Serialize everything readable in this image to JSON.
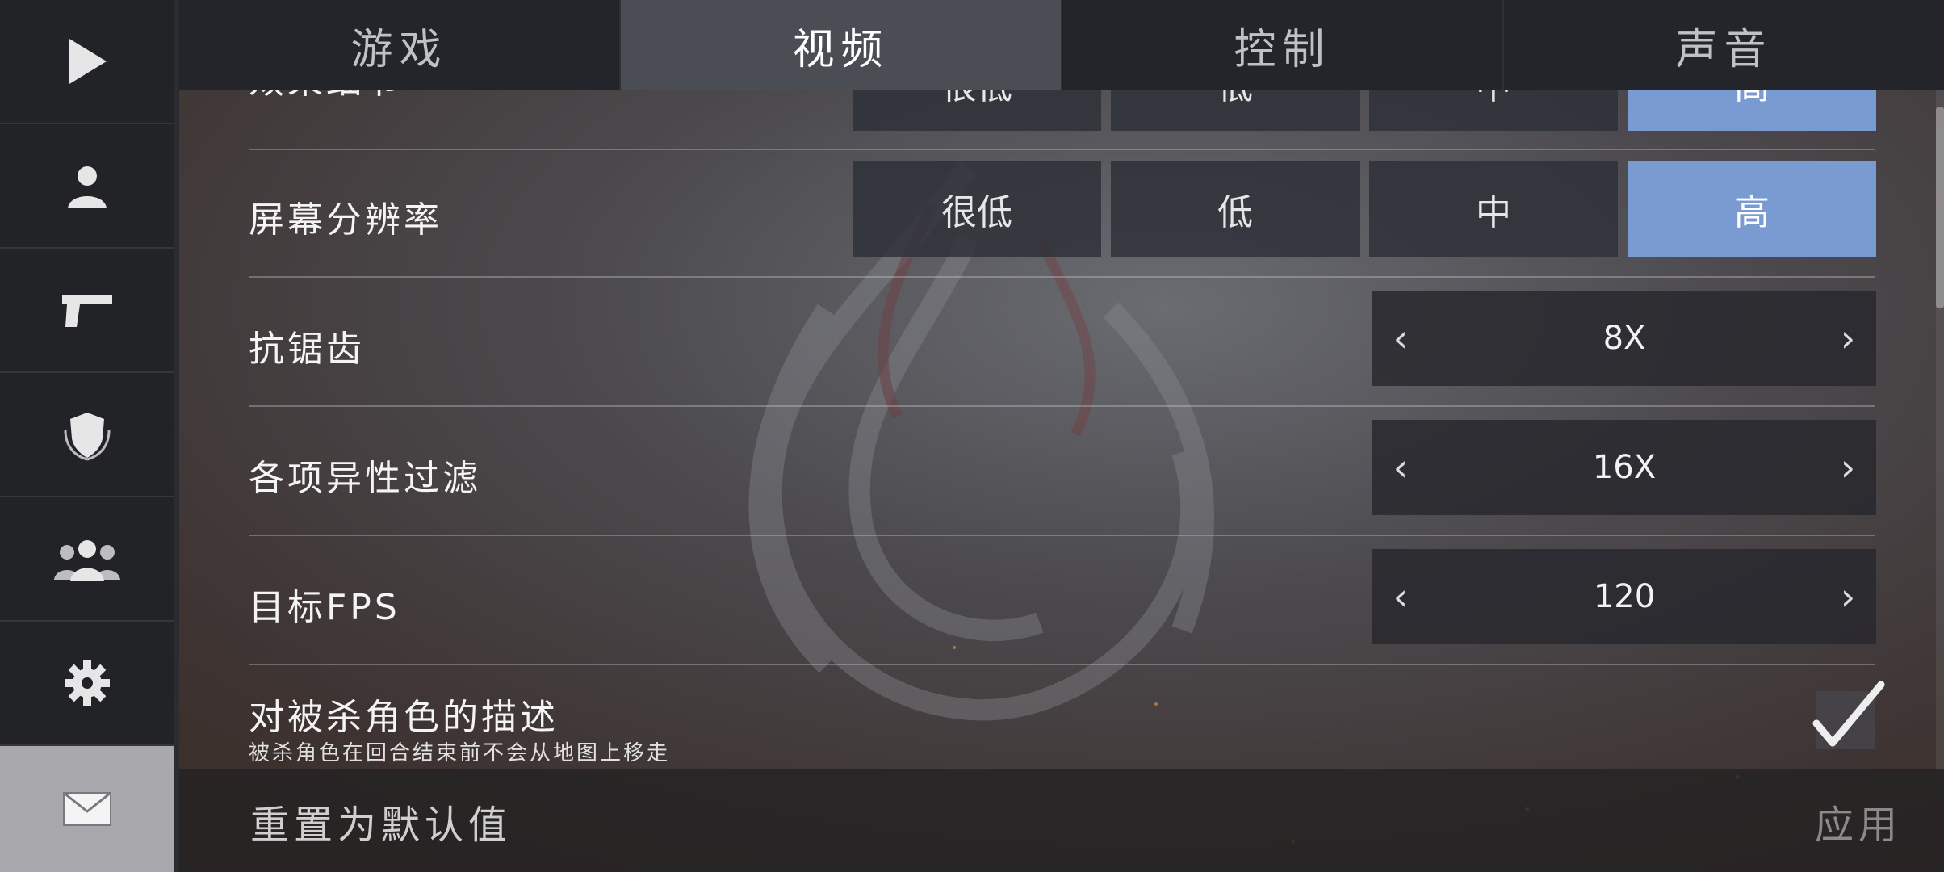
{
  "sidebar": {
    "items": [
      {
        "icon": "play-icon"
      },
      {
        "icon": "user-icon"
      },
      {
        "icon": "pistol-icon"
      },
      {
        "icon": "shield-badge-icon"
      },
      {
        "icon": "group-icon"
      },
      {
        "icon": "gear-icon"
      },
      {
        "icon": "mail-icon"
      }
    ]
  },
  "tabs": [
    {
      "label": "游戏",
      "active": false
    },
    {
      "label": "视频",
      "active": true
    },
    {
      "label": "控制",
      "active": false
    },
    {
      "label": "声音",
      "active": false
    }
  ],
  "settings": {
    "effects_detail": {
      "label": "效果细节",
      "options": [
        "很低",
        "低",
        "中",
        "高"
      ],
      "selected": "高"
    },
    "screen_resolution": {
      "label": "屏幕分辨率",
      "options": [
        "很低",
        "低",
        "中",
        "高"
      ],
      "selected": "高"
    },
    "anti_aliasing": {
      "label": "抗锯齿",
      "value": "8X"
    },
    "anisotropic_filtering": {
      "label": "各项异性过滤",
      "value": "16X"
    },
    "target_fps": {
      "label": "目标FPS",
      "value": "120"
    },
    "killed_character_description": {
      "label": "对被杀角色的描述",
      "description": "被杀角色在回合结束前不会从地图上移走",
      "checked": true
    }
  },
  "stepper": {
    "prev": "‹",
    "next": "›"
  },
  "footer": {
    "reset_label": "重置为默认值",
    "apply_label": "应用"
  },
  "colors": {
    "selected": "#7a9bd2",
    "sidebar_active": "#a9a9ad"
  }
}
